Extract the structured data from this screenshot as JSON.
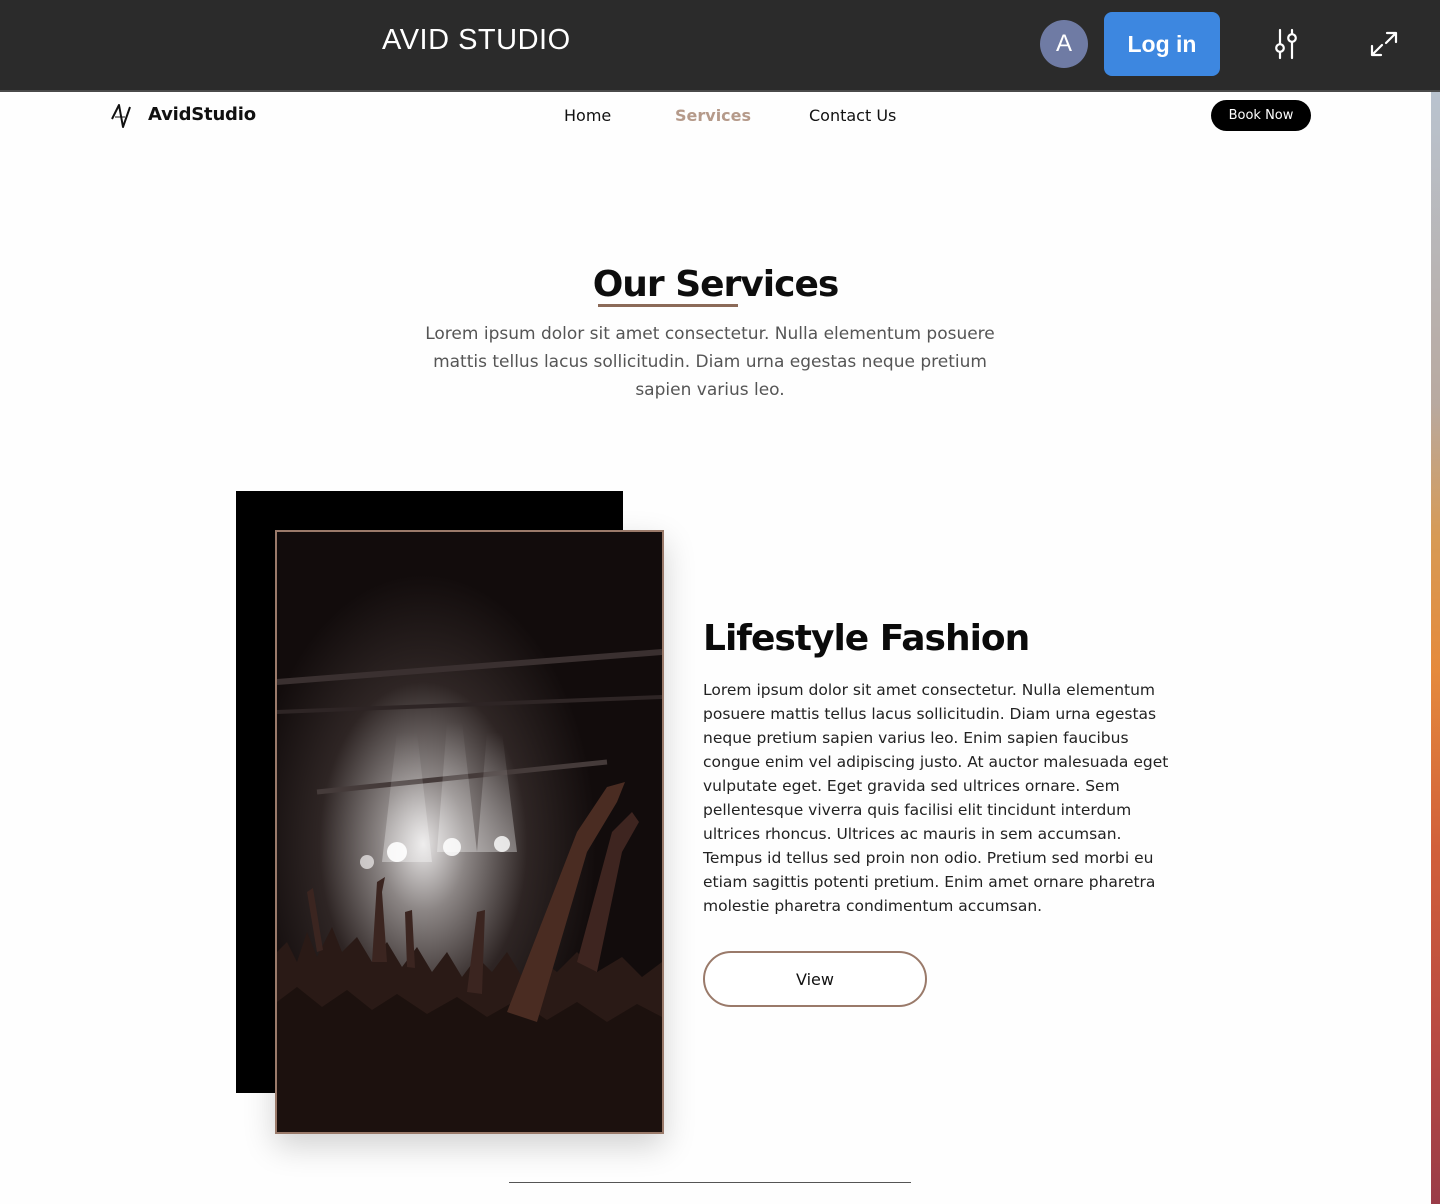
{
  "app_bar": {
    "title": "AVID STUDIO",
    "avatar_initial": "A",
    "login_label": "Log in",
    "settings_icon": "sliders-icon",
    "expand_icon": "expand-icon"
  },
  "nav": {
    "brand": "AvidStudio",
    "links": [
      {
        "label": "Home",
        "active": false
      },
      {
        "label": "Services",
        "active": true
      },
      {
        "label": "Contact Us",
        "active": false
      }
    ],
    "cta_label": "Book Now"
  },
  "hero": {
    "title": "Our Services",
    "description": "Lorem ipsum dolor sit amet consectetur. Nulla elementum posuere mattis tellus lacus sollicitudin. Diam urna egestas neque pretium sapien varius leo."
  },
  "service": {
    "title": "Lifestyle Fashion",
    "description": "Lorem ipsum dolor sit amet consectetur. Nulla elementum posuere mattis tellus lacus sollicitudin. Diam urna egestas neque pretium sapien varius leo. Enim sapien faucibus congue enim vel adipiscing justo. At auctor malesuada eget vulputate eget. Eget gravida sed ultrices ornare. Sem pellentesque viverra quis facilisi elit tincidunt interdum ultrices rhoncus. Ultrices ac mauris in sem accumsan. Tempus id tellus sed proin non odio. Pretium sed morbi eu etiam sagittis potenti pretium. Enim amet ornare pharetra molestie pharetra condimentum accumsan.",
    "button_label": "View",
    "image": "concert-crowd-photo"
  },
  "colors": {
    "app_bar_bg": "#2b2b2b",
    "login_button": "#3d87e0",
    "avatar_bg": "#6f7ba4",
    "accent_brown": "#8b6a58",
    "active_link": "#b59a8a"
  }
}
